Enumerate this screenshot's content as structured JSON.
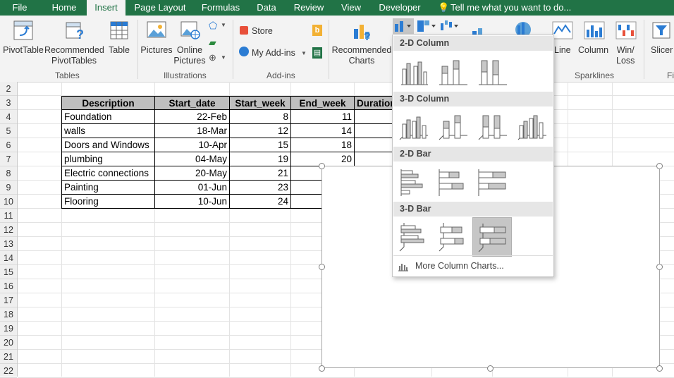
{
  "tabs": [
    "File",
    "Home",
    "Insert",
    "Page Layout",
    "Formulas",
    "Data",
    "Review",
    "View",
    "Developer"
  ],
  "active_tab": "Insert",
  "tell_me": "Tell me what you want to do...",
  "ribbon": {
    "pivot_table": "PivotTable",
    "recommended_pivot_1": "Recommended",
    "recommended_pivot_2": "PivotTables",
    "table": "Table",
    "group_tables": "Tables",
    "pictures": "Pictures",
    "online_pictures_1": "Online",
    "online_pictures_2": "Pictures",
    "group_illustrations": "Illustrations",
    "store": "Store",
    "my_addins": "My Add-ins",
    "group_addins": "Add-ins",
    "recommended_charts_1": "Recommended",
    "recommended_charts_2": "Charts",
    "spark_line": "Line",
    "spark_column": "Column",
    "winloss_1": "Win/",
    "winloss_2": "Loss",
    "group_sparklines": "Sparklines",
    "slicer": "Slicer",
    "group_filters_partial": "Fi"
  },
  "rows": [
    "2",
    "3",
    "4",
    "5",
    "6",
    "7",
    "8",
    "9",
    "10",
    "11",
    "12",
    "13",
    "14",
    "15",
    "16",
    "17",
    "18",
    "19",
    "20",
    "21",
    "22"
  ],
  "table": {
    "headers": [
      "Description",
      "Start_date",
      "Start_week",
      "End_week",
      "Duration"
    ],
    "rows": [
      {
        "desc": "Foundation",
        "start": "22-Feb",
        "sweek": "8",
        "eweek": "11"
      },
      {
        "desc": "walls",
        "start": "18-Mar",
        "sweek": "12",
        "eweek": "14"
      },
      {
        "desc": "Doors and Windows",
        "start": "10-Apr",
        "sweek": "15",
        "eweek": "18"
      },
      {
        "desc": "plumbing",
        "start": "04-May",
        "sweek": "19",
        "eweek": "20"
      },
      {
        "desc": "Electric connections",
        "start": "20-May",
        "sweek": "21",
        "eweek": ""
      },
      {
        "desc": "Painting",
        "start": "01-Jun",
        "sweek": "23",
        "eweek": ""
      },
      {
        "desc": "Flooring",
        "start": "10-Jun",
        "sweek": "24",
        "eweek": ""
      }
    ]
  },
  "dropdown": {
    "sections": [
      "2-D Column",
      "3-D Column",
      "2-D Bar",
      "3-D Bar"
    ],
    "more": "More Column Charts...",
    "selected": "3-D 100% Stacked Bar"
  },
  "colors": {
    "accent": "#217346",
    "ribbon": "#f3f3f3",
    "header_fill": "#bfbfbf",
    "selection": "#c6c6c6"
  }
}
